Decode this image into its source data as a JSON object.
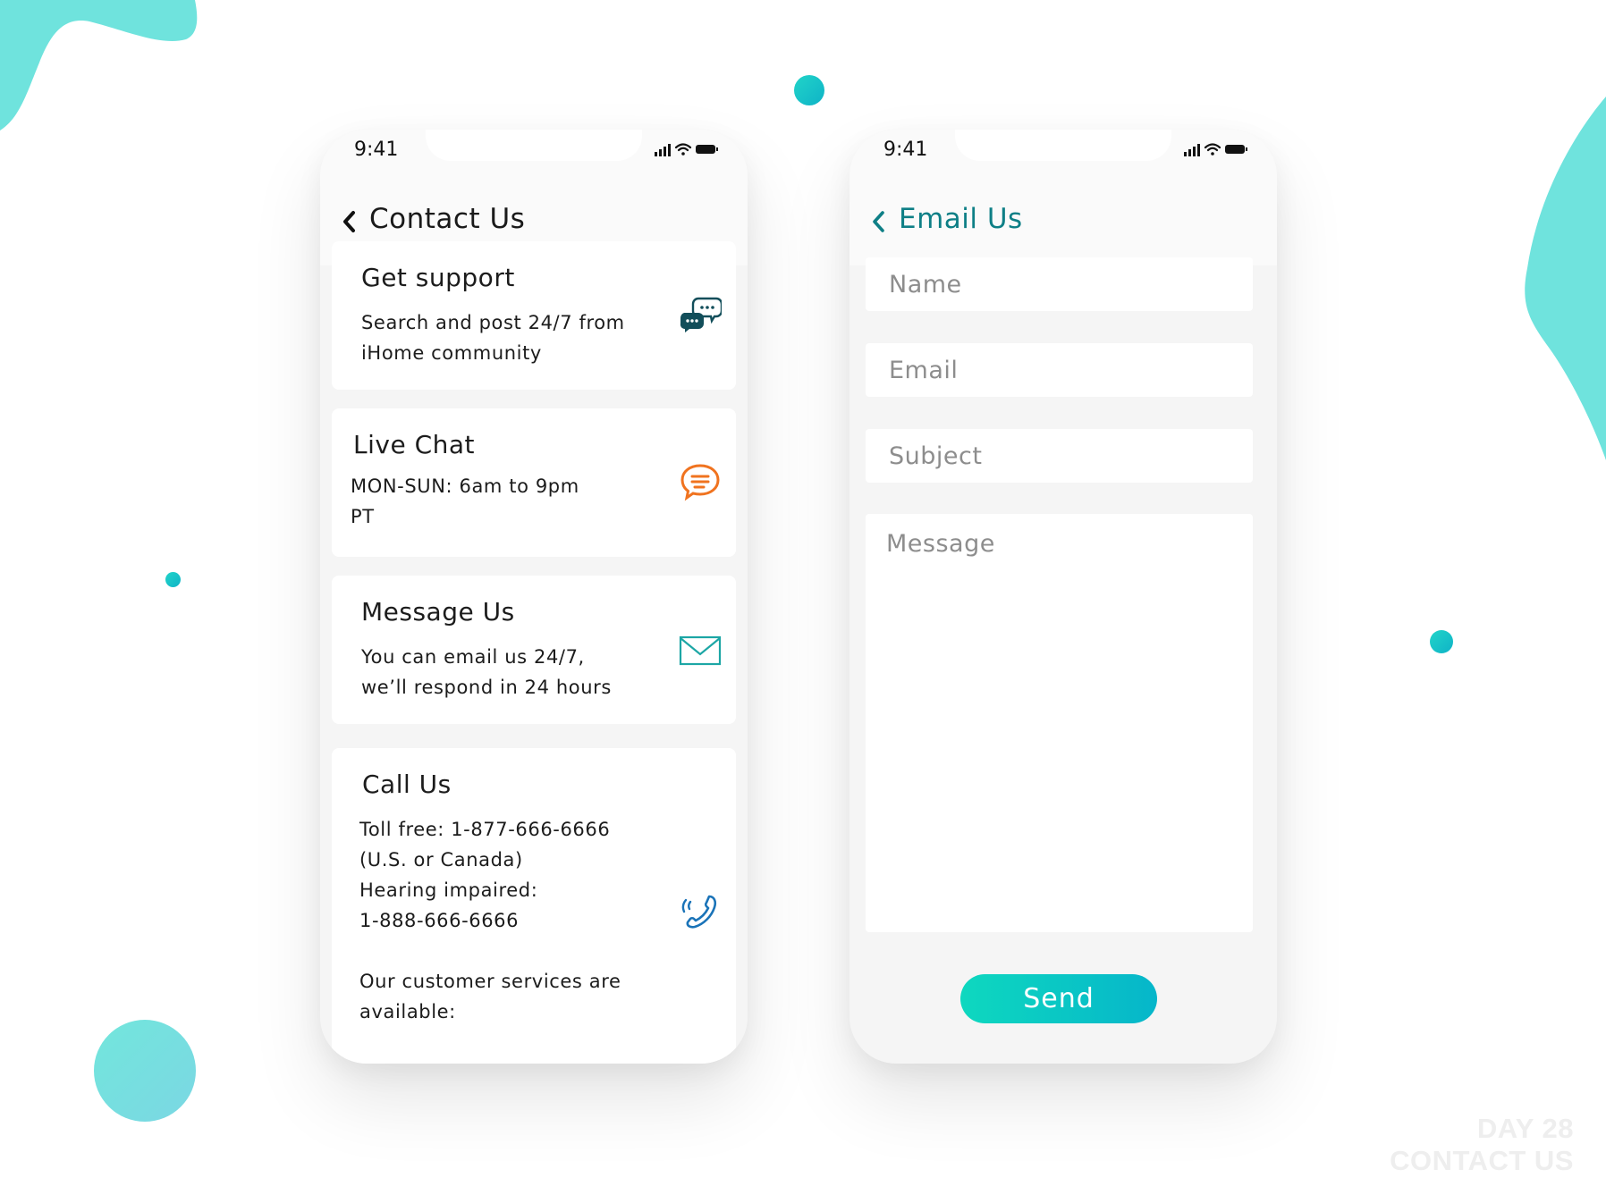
{
  "colors": {
    "accent": "#1cc9c7",
    "blob": "#6fe3dd",
    "title_teal": "#0e7f86",
    "chat_orange": "#f0731f",
    "icon_dark_teal": "#124e5a"
  },
  "left_phone": {
    "status": {
      "time": "9:41"
    },
    "nav": {
      "title": "Contact Us",
      "back_icon": "chevron-left-icon"
    },
    "cards": [
      {
        "title": "Get support",
        "text": "Search and post 24/7 from\niHome community",
        "icon": "chat-bubbles-icon"
      },
      {
        "title": "Live Chat",
        "text": "MON-SUN: 6am to 9pm\nPT",
        "icon": "chat-bubble-icon"
      },
      {
        "title": "Message Us",
        "text": "You can email us 24/7,\nwe’ll respond in 24 hours",
        "icon": "envelope-icon"
      },
      {
        "title": "Call Us",
        "text": "Toll free: 1-877-666-6666\n(U.S. or Canada)\nHearing impaired:\n1-888-666-6666\n\nOur customer services are\navailable:",
        "icon": "phone-icon"
      }
    ]
  },
  "right_phone": {
    "status": {
      "time": "9:41"
    },
    "nav": {
      "title": "Email Us",
      "back_icon": "chevron-left-icon"
    },
    "form": {
      "name_placeholder": "Name",
      "email_placeholder": "Email",
      "subject_placeholder": "Subject",
      "message_placeholder": "Message",
      "send_label": "Send"
    }
  },
  "watermark": {
    "line1": "DAY 28",
    "line2": "CONTACT US"
  }
}
